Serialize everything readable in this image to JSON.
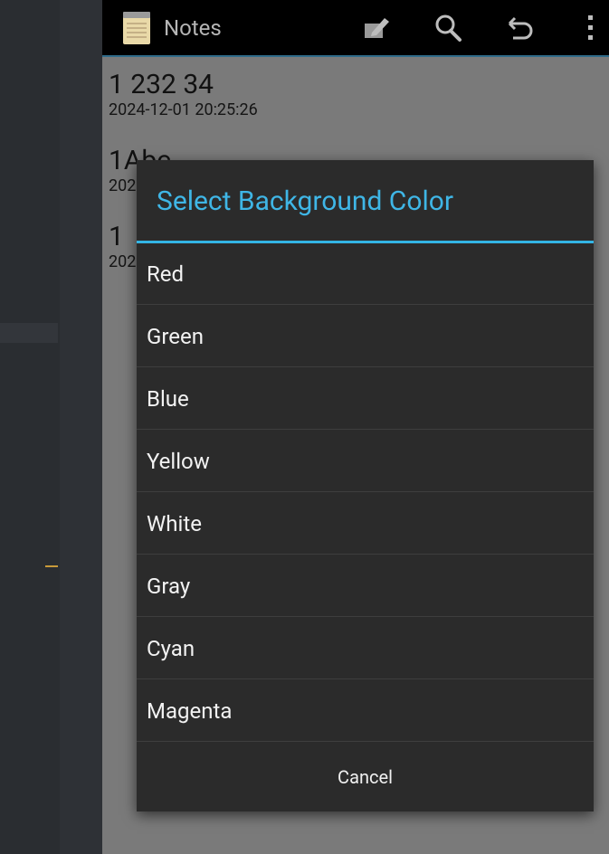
{
  "app": {
    "title": "Notes",
    "actions": [
      "new-note-icon",
      "search-icon",
      "undo-icon",
      "overflow-menu-icon"
    ]
  },
  "notes": [
    {
      "title": "1 232 34",
      "date": "2024-12-01 20:25:26"
    },
    {
      "title": "1Abc",
      "date": "202"
    },
    {
      "title": "1",
      "date": "202"
    }
  ],
  "dialog": {
    "title": "Select Background Color",
    "options": [
      "Red",
      "Green",
      "Blue",
      "Yellow",
      "White",
      "Gray",
      "Cyan",
      "Magenta"
    ],
    "cancel_label": "Cancel"
  },
  "colors": {
    "accent": "#33b5e5",
    "dialog_bg": "#2b2b2b",
    "actionbar_bg": "#000000"
  }
}
